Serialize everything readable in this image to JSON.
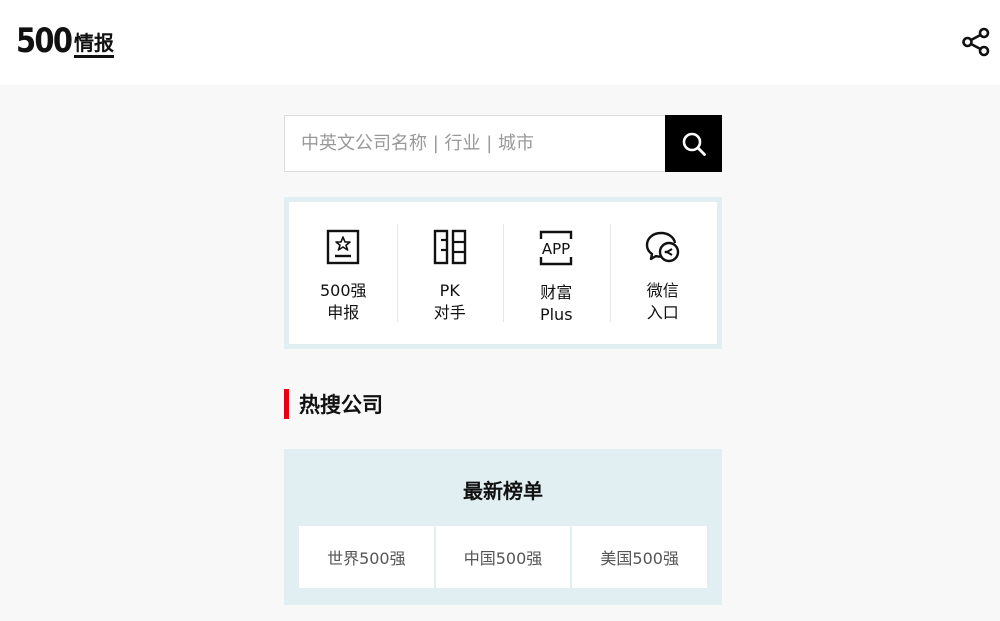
{
  "header": {
    "logo_number": "500",
    "logo_text": "情报",
    "share_icon": "share-icon"
  },
  "search": {
    "placeholder": "中英文公司名称 | 行业 | 城市",
    "value": "",
    "button_icon": "search-icon"
  },
  "quick_links": [
    {
      "line1": "500强",
      "line2": "申报",
      "icon": "star-badge-icon"
    },
    {
      "line1": "PK",
      "line2": "对手",
      "icon": "compare-icon"
    },
    {
      "line1": "财富",
      "line2": "Plus",
      "icon": "app-icon"
    },
    {
      "line1": "微信",
      "line2": "入口",
      "icon": "wechat-icon"
    }
  ],
  "hot_search": {
    "title": "热搜公司"
  },
  "rankings": {
    "title": "最新榜单",
    "tabs": [
      "世界500强",
      "中国500强",
      "美国500强"
    ]
  },
  "colors": {
    "accent": "#e60012",
    "panel_bg": "#e2eff2",
    "page_bg": "#f8f8f9"
  }
}
